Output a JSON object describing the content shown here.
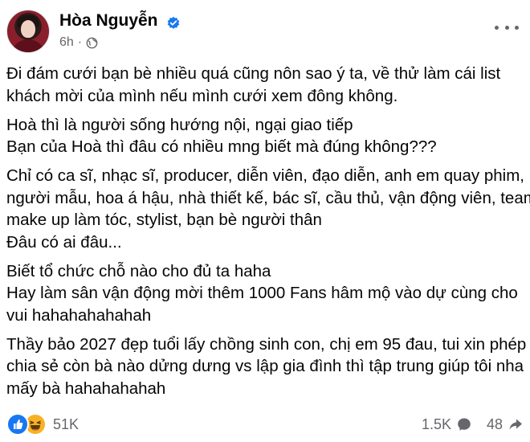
{
  "post": {
    "author_name": "Hòa Nguyễn",
    "time": "6h",
    "separator": "·",
    "paragraphs": [
      [
        "Đi đám cưới bạn bè nhiều quá cũng nôn sao ý ta, về thử làm cái list",
        "khách mời của mình nếu mình cưới xem đông không."
      ],
      [
        "Hoà thì là người sống hướng nội, ngại giao tiếp",
        "Bạn của Hoà thì đâu có nhiều mng biết mà đúng không???"
      ],
      [
        "Chỉ có ca sĩ, nhạc sĩ, producer, diễn viên, đạo diễn, anh em quay phim,",
        "người mẫu, hoa á hậu, nhà thiết kế, bác sĩ, cầu thủ, vận động viên, team",
        "make up làm tóc, stylist, bạn bè người thân",
        "Đâu có ai đâu..."
      ],
      [
        "Biết tổ chức chỗ nào cho đủ ta haha",
        "Hay làm sân vận động mời thêm 1000 Fans hâm mộ vào dự cùng cho",
        "vui hahahahahahah"
      ],
      [
        "Thầy bảo 2027 đẹp tuổi lấy chồng sinh con, chị em 95 đau, tui xin phép",
        "chia sẻ còn bà nào dửng dưng vs lập gia đình thì tập trung giúp tôi nha",
        "mấy bà hahahahahah"
      ]
    ]
  },
  "footer": {
    "reactions_count": "51K",
    "comments_count": "1.5K",
    "shares_count": "48"
  },
  "icons": {
    "verified": "verified-badge-icon",
    "audience": "globe-icon",
    "more": "more-options-icon",
    "like": "like-reaction-icon",
    "haha": "haha-reaction-icon",
    "comment": "comment-icon",
    "share": "share-icon"
  },
  "colors": {
    "accent": "#1877f2",
    "secondary_text": "#65676b",
    "primary_text": "#050505",
    "haha": "#f7b125"
  }
}
